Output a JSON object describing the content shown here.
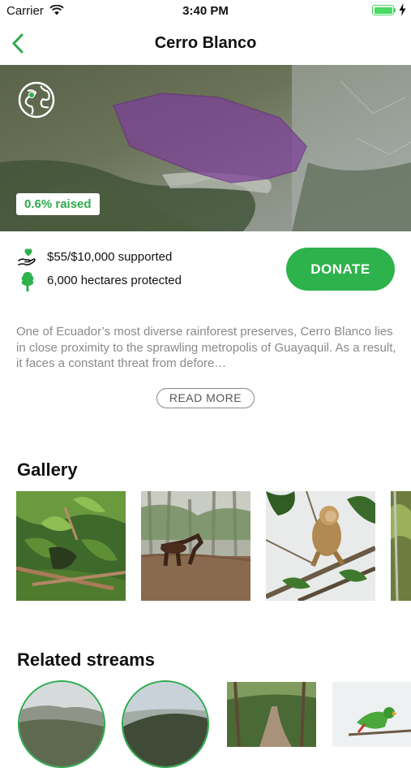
{
  "status_bar": {
    "carrier": "Carrier",
    "time": "3:40 PM"
  },
  "header": {
    "title": "Cerro Blanco"
  },
  "map": {
    "raised_badge": "0.6% raised"
  },
  "stats": {
    "supported": "$55/$10,000 supported",
    "protected": "6,000 hectares protected"
  },
  "donate_label": "DONATE",
  "description": "One of Ecuador’s most diverse rainforest preserves, Cerro Blanco lies in close proximity to the sprawling metropolis of Guayaquil. As a result, it faces a constant threat from defore…",
  "read_more_label": "READ MORE",
  "gallery": {
    "title": "Gallery"
  },
  "related": {
    "title": "Related streams"
  },
  "colors": {
    "accent": "#2eb24c",
    "battery": "#4cd964",
    "text_muted": "#8a8a8a"
  }
}
